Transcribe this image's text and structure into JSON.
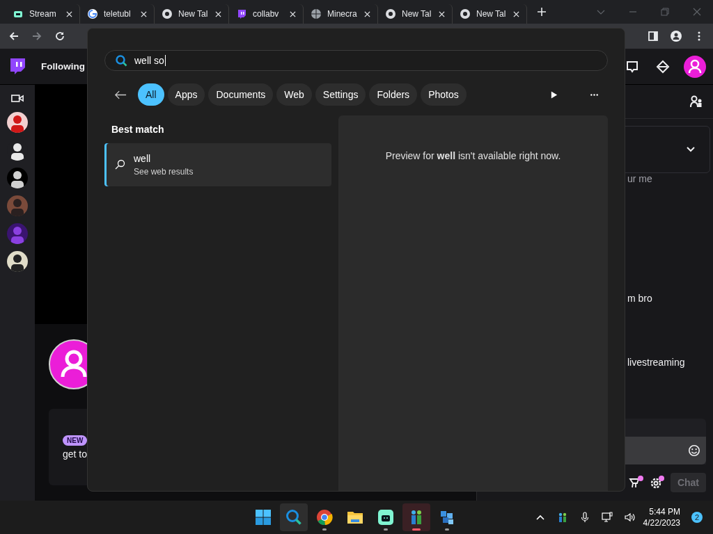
{
  "browser": {
    "tabs": [
      {
        "title": "Stream"
      },
      {
        "title": "teletubl"
      },
      {
        "title": "New Tal"
      },
      {
        "title": "collabv"
      },
      {
        "title": "Minecra"
      },
      {
        "title": "New Tal"
      },
      {
        "title": "New Tal"
      }
    ]
  },
  "twitch": {
    "nav_label": "Following"
  },
  "stream": {
    "badge": "NEW",
    "text": "get to"
  },
  "chat": {
    "lines": [
      "ur me",
      "m bro",
      "livestreaming"
    ],
    "send_label": "Chat"
  },
  "search": {
    "query": "well so",
    "filters": [
      {
        "label": "All",
        "selected": true
      },
      {
        "label": "Apps",
        "selected": false
      },
      {
        "label": "Documents",
        "selected": false
      },
      {
        "label": "Web",
        "selected": false
      },
      {
        "label": "Settings",
        "selected": false
      },
      {
        "label": "Folders",
        "selected": false
      },
      {
        "label": "Photos",
        "selected": false
      }
    ],
    "section": "Best match",
    "result": {
      "title": "well",
      "subtitle": "See web results",
      "selected": true
    },
    "preview": "Preview for **well** isn't available right now."
  },
  "taskbar": {
    "apps": [
      {
        "kind": "start",
        "running": false,
        "selected": false
      },
      {
        "kind": "search",
        "running": false,
        "selected": true
      },
      {
        "kind": "chrome",
        "running": true,
        "selected": false
      },
      {
        "kind": "files",
        "running": false,
        "selected": false
      },
      {
        "kind": "streamdeck",
        "running": true,
        "selected": false
      },
      {
        "kind": "people",
        "running": true,
        "selected": true
      },
      {
        "kind": "cubes",
        "running": true,
        "selected": false
      }
    ],
    "time": "5:44 PM",
    "date": "4/22/2023",
    "notifications": "2"
  }
}
